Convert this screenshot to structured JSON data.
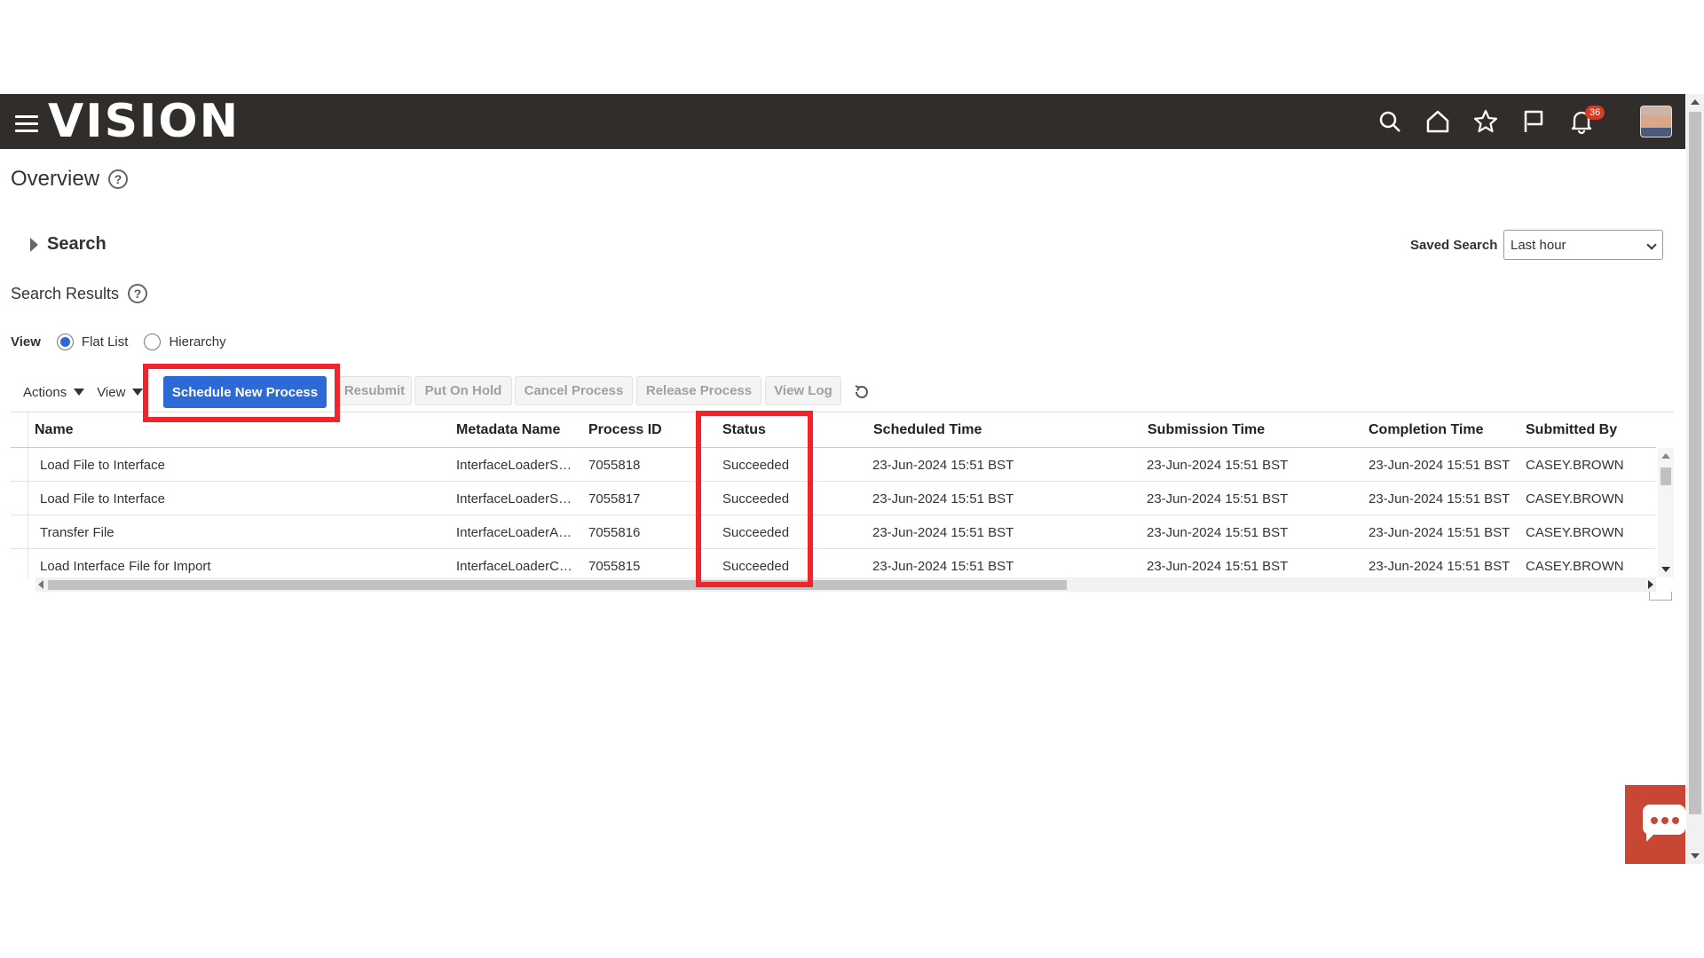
{
  "header": {
    "logo": "VISION",
    "notification_count": "36"
  },
  "page": {
    "title": "Overview",
    "search_label": "Search",
    "saved_search_label": "Saved Search",
    "saved_search_value": "Last hour",
    "results_title": "Search Results"
  },
  "view": {
    "label": "View",
    "options": [
      "Flat List",
      "Hierarchy"
    ],
    "selected": "Flat List"
  },
  "toolbar": {
    "actions": "Actions",
    "view": "View",
    "schedule": "Schedule New Process",
    "resubmit": "Resubmit",
    "hold": "Put On Hold",
    "cancel": "Cancel Process",
    "release": "Release Process",
    "log": "View Log"
  },
  "table": {
    "columns": [
      "Name",
      "Metadata Name",
      "Process ID",
      "Status",
      "Scheduled Time",
      "Submission Time",
      "Completion Time",
      "Submitted By"
    ],
    "rows": [
      [
        "Load File to Interface",
        "InterfaceLoaderS…",
        "7055818",
        "Succeeded",
        "23-Jun-2024 15:51 BST",
        "23-Jun-2024 15:51 BST",
        "23-Jun-2024 15:51 BST",
        "CASEY.BROWN"
      ],
      [
        "Load File to Interface",
        "InterfaceLoaderS…",
        "7055817",
        "Succeeded",
        "23-Jun-2024 15:51 BST",
        "23-Jun-2024 15:51 BST",
        "23-Jun-2024 15:51 BST",
        "CASEY.BROWN"
      ],
      [
        "Transfer File",
        "InterfaceLoaderA…",
        "7055816",
        "Succeeded",
        "23-Jun-2024 15:51 BST",
        "23-Jun-2024 15:51 BST",
        "23-Jun-2024 15:51 BST",
        "CASEY.BROWN"
      ],
      [
        "Load Interface File for Import",
        "InterfaceLoaderC…",
        "7055815",
        "Succeeded",
        "23-Jun-2024 15:51 BST",
        "23-Jun-2024 15:51 BST",
        "23-Jun-2024 15:51 BST",
        "CASEY.BROWN"
      ]
    ]
  },
  "colors": {
    "header_bg": "#312d2a",
    "primary": "#2d6ad6",
    "highlight": "#f2242b",
    "chat": "#c74634"
  }
}
